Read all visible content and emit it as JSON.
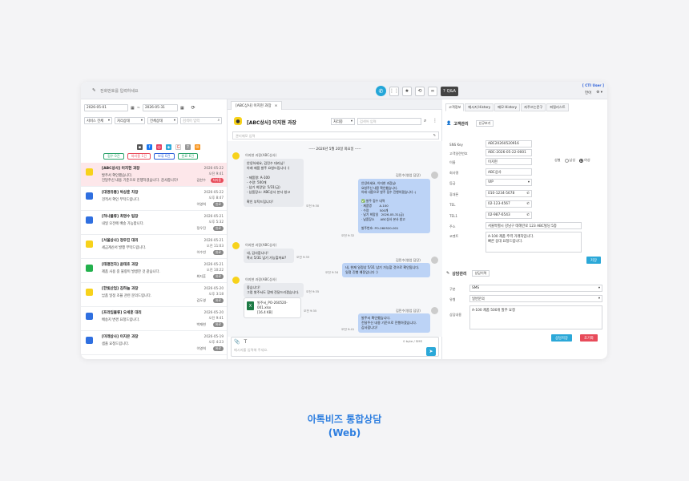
{
  "topbar": {
    "phone_placeholder": "전화번호를 입력하세요",
    "qa_label": "Q&A",
    "cti_user": "[ CTI User ]",
    "lang": "언어"
  },
  "filters": {
    "date_from": "2026-05-01",
    "date_to": "2026-05-31",
    "service": "서비스 전체",
    "status": "처리상태",
    "channel": "전체상태",
    "search_placeholder": "검색어 입력",
    "chips": [
      "접수 0건",
      "처리중 1건",
      "보류 0건",
      "완료 6건"
    ]
  },
  "conversations": [
    {
      "name": "[ABC상사] 이지현 과장",
      "msg": "발주서 확인했습니다.\n전달주신 내용 기준으로 진행하겠습니다. 감사합니다!",
      "date": "2026-05-22",
      "time": "오전 9:41",
      "agent": "김한수",
      "status": "처리중",
      "color": "#f7d21b"
    },
    {
      "name": "[대명유통] 박상훈 차장",
      "msg": "견적서 확인 부탁드립니다.",
      "date": "2026-05-22",
      "time": "오후 8:47",
      "agent": "이영희",
      "status": "완료",
      "color": "#2f6fe0"
    },
    {
      "name": "[하나물류] 최영수 팀장",
      "msg": "내일 오전에 배송 가능합니다.",
      "date": "2026-05-21",
      "time": "오후 5:32",
      "agent": "정우진",
      "status": "완료",
      "color": "#2f6fe0"
    },
    {
      "name": "[서울상사] 정우진 대리",
      "msg": "세금계산서 발행 부탁드립니다.",
      "date": "2026-05-21",
      "time": "오전 11:03",
      "agent": "이수빈",
      "status": "완료",
      "color": "#f7d21b"
    },
    {
      "name": "[태평전자] 윤태호 과장",
      "msg": "제품 사용 중 불량이 발생한 것 같습니다.",
      "date": "2026-05-21",
      "time": "오전 10:22",
      "agent": "최지훈",
      "status": "완료",
      "color": "#23b14d"
    },
    {
      "name": "[한빛산업] 김하늘 과장",
      "msg": "납품 일정 조율 관련 문의드립니다.",
      "date": "2026-05-20",
      "time": "오후 3:18",
      "agent": "김도영",
      "status": "완료",
      "color": "#f7d21b"
    },
    {
      "name": "[프라임물류] 오세훈 대리",
      "msg": "배송지 변경 요청드립니다.",
      "date": "2026-05-20",
      "time": "오전 9:41",
      "agent": "박재현",
      "status": "완료",
      "color": "#2f6fe0"
    },
    {
      "name": "[미래상사] 이지은 과장",
      "msg": "샘플 요청드립니다.",
      "date": "2026-05-19",
      "time": "오후 4:23",
      "agent": "이영희",
      "status": "완료",
      "color": "#2f6fe0"
    }
  ],
  "chat": {
    "tab_label": "[ABC상사] 이지현 과장",
    "title": "[ABC상사] 이지현 과장",
    "select_label": "처리중",
    "search_placeholder": "검색어 입력",
    "memo_placeholder": "관리메모 입력",
    "date_divider": "----- 2026년 5월 20일 화요일 -----",
    "messages": [
      {
        "dir": "in",
        "sender": "이지현 과장(ABC상사)",
        "text": "안녕하세요, 김민수 대리님!\n아래 제품 발주 요청드립니다 :)\n\n- 제품명: A-100\n- 수량: 500개\n- 납기 희망일: 5/31(금)\n- 납품장소: ABC상사 본사 창고\n\n확인 부탁드립니다!",
        "time": "오전 9:30"
      },
      {
        "dir": "out",
        "sender": "김민수(영업 담당)",
        "text": "안녕하세요, 이지현 과장님!\n요청주신 내용 확인했습니다.\n아래 내용으로 발주 접수 진행하겠습니다 :)\n\n✅ 발주 접수 내역\n· 제품명        A-100\n· 수량           500개\n· 납기 희망일   2026-05-31(금)\n· 납품장소      ABC상사 본사 창고\n\n발주번호: PO-260520-001",
        "time": "오전 9:32"
      },
      {
        "dir": "in",
        "sender": "이지현 과장(ABC상사)",
        "text": "네, 감사합니다!\n혹시 5/31 납기 가능할까요?",
        "time": "오전 9:33"
      },
      {
        "dir": "out",
        "sender": "김민수(영업 담당)",
        "text": "네, 현재 일정상 5/31 납기 가능할 것으로 확인됩니다.\n일정 진행 예정입니다 :)",
        "time": "오전 9:34"
      },
      {
        "dir": "in",
        "sender": "이지현 과장(ABC상사)",
        "text": "좋습니다!\n그럼 발주서도 함께 전달드리겠습니다.",
        "time": "오전 9:35"
      },
      {
        "dir": "file",
        "file_name": "발주서_PO-260520-001.xlsx",
        "file_size": "[16.4 KB]",
        "time": "오전 9:35"
      },
      {
        "dir": "out",
        "sender": "김민수(영업 담당)",
        "text": "발주서 확인했습니다.\n전달주신 내용 기준으로 진행하겠습니다.\n감사합니다!",
        "time": "오전 9:41"
      }
    ],
    "byte_count": "0 byte / SMS",
    "input_placeholder": "메시지를 입력해 주세요."
  },
  "customer": {
    "tabs": [
      "고객정보",
      "메시지 History",
      "메모 History",
      "자주쓰는문구",
      "퍼질리스트"
    ],
    "section_title": "고객관리",
    "new_btn": "신규보기",
    "fields": [
      {
        "label": "SNS Key",
        "value": "ABC20260520916"
      },
      {
        "label": "고객일련번호",
        "value": "ABC-2026-05-22-0001"
      },
      {
        "label": "이름",
        "value": "이지현"
      },
      {
        "label": "회사명",
        "value": "ABC상사"
      },
      {
        "label": "등급",
        "value": "VIP"
      },
      {
        "label": "휴대폰",
        "value": "010-1234-5678"
      },
      {
        "label": "TEL",
        "value": "02-123-4567"
      },
      {
        "label": "TEL1",
        "value": "02-987-6543"
      },
      {
        "label": "주소",
        "value": "서울특별시 강남구 테헤란로 123 ABC빌딩 5층"
      },
      {
        "label": "코멘트",
        "value": "A-100 제품 주력 거래처입니다.\n빠른 응대 요청드립니다."
      }
    ],
    "gender_label": "성별",
    "gender_male": "남성",
    "gender_female": "여성",
    "save_btn": "저장",
    "consult_title": "상담관리",
    "consult_history_btn": "상담이력",
    "consult_fields": [
      {
        "label": "구분",
        "value": "SMS"
      },
      {
        "label": "유형",
        "value": "일반문의"
      },
      {
        "label": "상담내용",
        "value": "A-100 제품 500개 발주 요청"
      }
    ],
    "consult_save_btn": "상담저장",
    "reset_btn": "초기화"
  },
  "caption": {
    "line1": "아톡비즈 통합상담",
    "line2": "(Web)"
  },
  "colors": {
    "accent": "#2ba8d8",
    "danger": "#e84b5a",
    "bubble_out": "#bcd3f6",
    "caption": "#2f7fe0"
  }
}
